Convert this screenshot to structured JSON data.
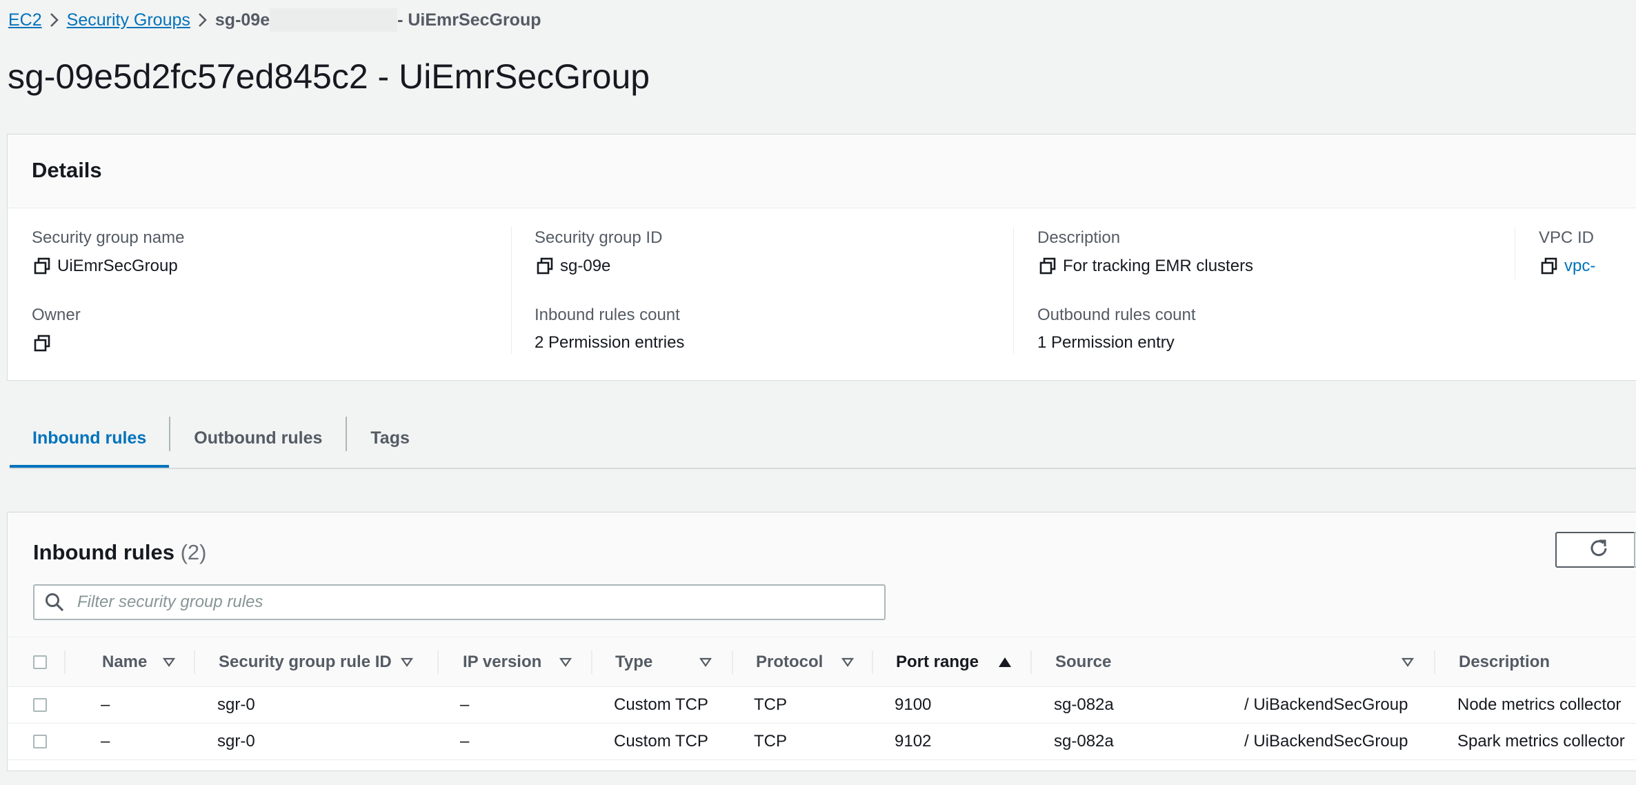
{
  "breadcrumb": {
    "items": [
      "EC2",
      "Security Groups"
    ],
    "current_prefix": "sg-09e",
    "current_suffix": " - UiEmrSecGroup"
  },
  "page_title": "sg-09e5d2fc57ed845c2 - UiEmrSecGroup",
  "details": {
    "heading": "Details",
    "fields": {
      "sg_name": {
        "label": "Security group name",
        "value": "UiEmrSecGroup"
      },
      "sg_id": {
        "label": "Security group ID",
        "value": "sg-09e"
      },
      "description": {
        "label": "Description",
        "value": "For tracking EMR clusters"
      },
      "vpc_id": {
        "label": "VPC ID",
        "value": "vpc-"
      },
      "owner": {
        "label": "Owner",
        "value": ""
      },
      "inbound_count": {
        "label": "Inbound rules count",
        "value": "2 Permission entries"
      },
      "outbound_count": {
        "label": "Outbound rules count",
        "value": "1 Permission entry"
      }
    }
  },
  "tabs": [
    "Inbound rules",
    "Outbound rules",
    "Tags"
  ],
  "active_tab": "Inbound rules",
  "inbound": {
    "title": "Inbound rules",
    "count": "(2)",
    "filter_placeholder": "Filter security group rules",
    "columns": [
      "Name",
      "Security group rule ID",
      "IP version",
      "Type",
      "Protocol",
      "Port range",
      "Source",
      "Description"
    ],
    "sorted_column": "Port range",
    "rows": [
      {
        "name": "–",
        "rule_id": "sgr-0",
        "ip_version": "–",
        "type": "Custom TCP",
        "protocol": "TCP",
        "port_range": "9100",
        "source_id": "sg-082a",
        "source_name": "/ UiBackendSecGroup",
        "description": "Node metrics collector"
      },
      {
        "name": "–",
        "rule_id": "sgr-0",
        "ip_version": "–",
        "type": "Custom TCP",
        "protocol": "TCP",
        "port_range": "9102",
        "source_id": "sg-082a",
        "source_name": "/ UiBackendSecGroup",
        "description": "Spark metrics collector"
      }
    ]
  },
  "colors": {
    "link": "#0073bb",
    "background": "#f2f3f3",
    "text": "#16191f",
    "muted": "#545b64"
  }
}
